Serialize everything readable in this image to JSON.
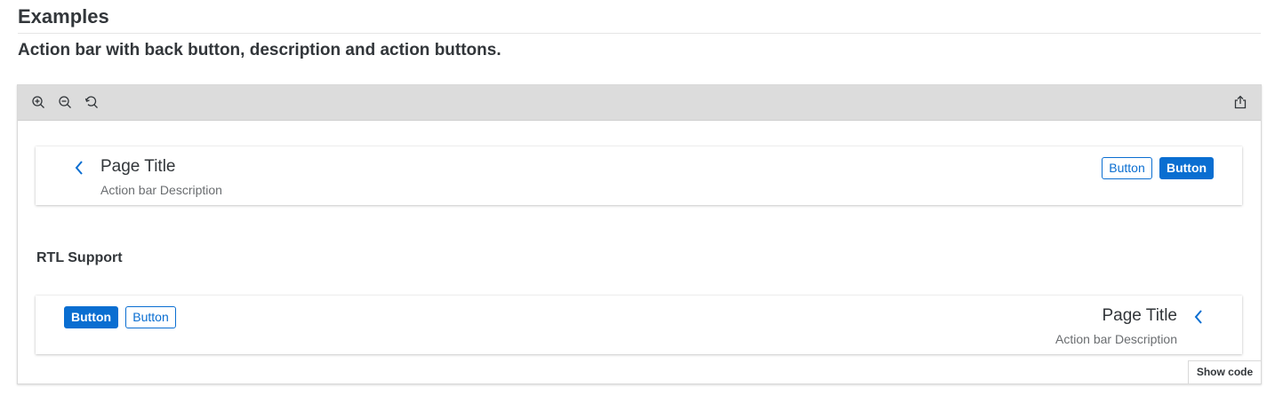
{
  "section": {
    "heading": "Examples",
    "description": "Action bar with back button, description and action buttons."
  },
  "toolbar": {
    "tools": [
      {
        "name": "zoom-in",
        "icon": "zoom-in-icon"
      },
      {
        "name": "zoom-out",
        "icon": "zoom-out-icon"
      },
      {
        "name": "reset-zoom",
        "icon": "reset-icon"
      }
    ],
    "share_icon": "share-icon"
  },
  "action_bar_ltr": {
    "title": "Page Title",
    "description": "Action bar Description",
    "buttons": [
      "Button",
      "Button"
    ]
  },
  "rtl_label": "RTL Support",
  "action_bar_rtl": {
    "title": "Page Title",
    "description": "Action bar Description",
    "buttons": [
      "Button",
      "Button"
    ]
  },
  "show_code_label": "Show code",
  "colors": {
    "accent": "#0a6ed1",
    "toolbar_bg": "#dcdcdc",
    "text": "#32363a",
    "secondary_text": "#6a6d70"
  }
}
